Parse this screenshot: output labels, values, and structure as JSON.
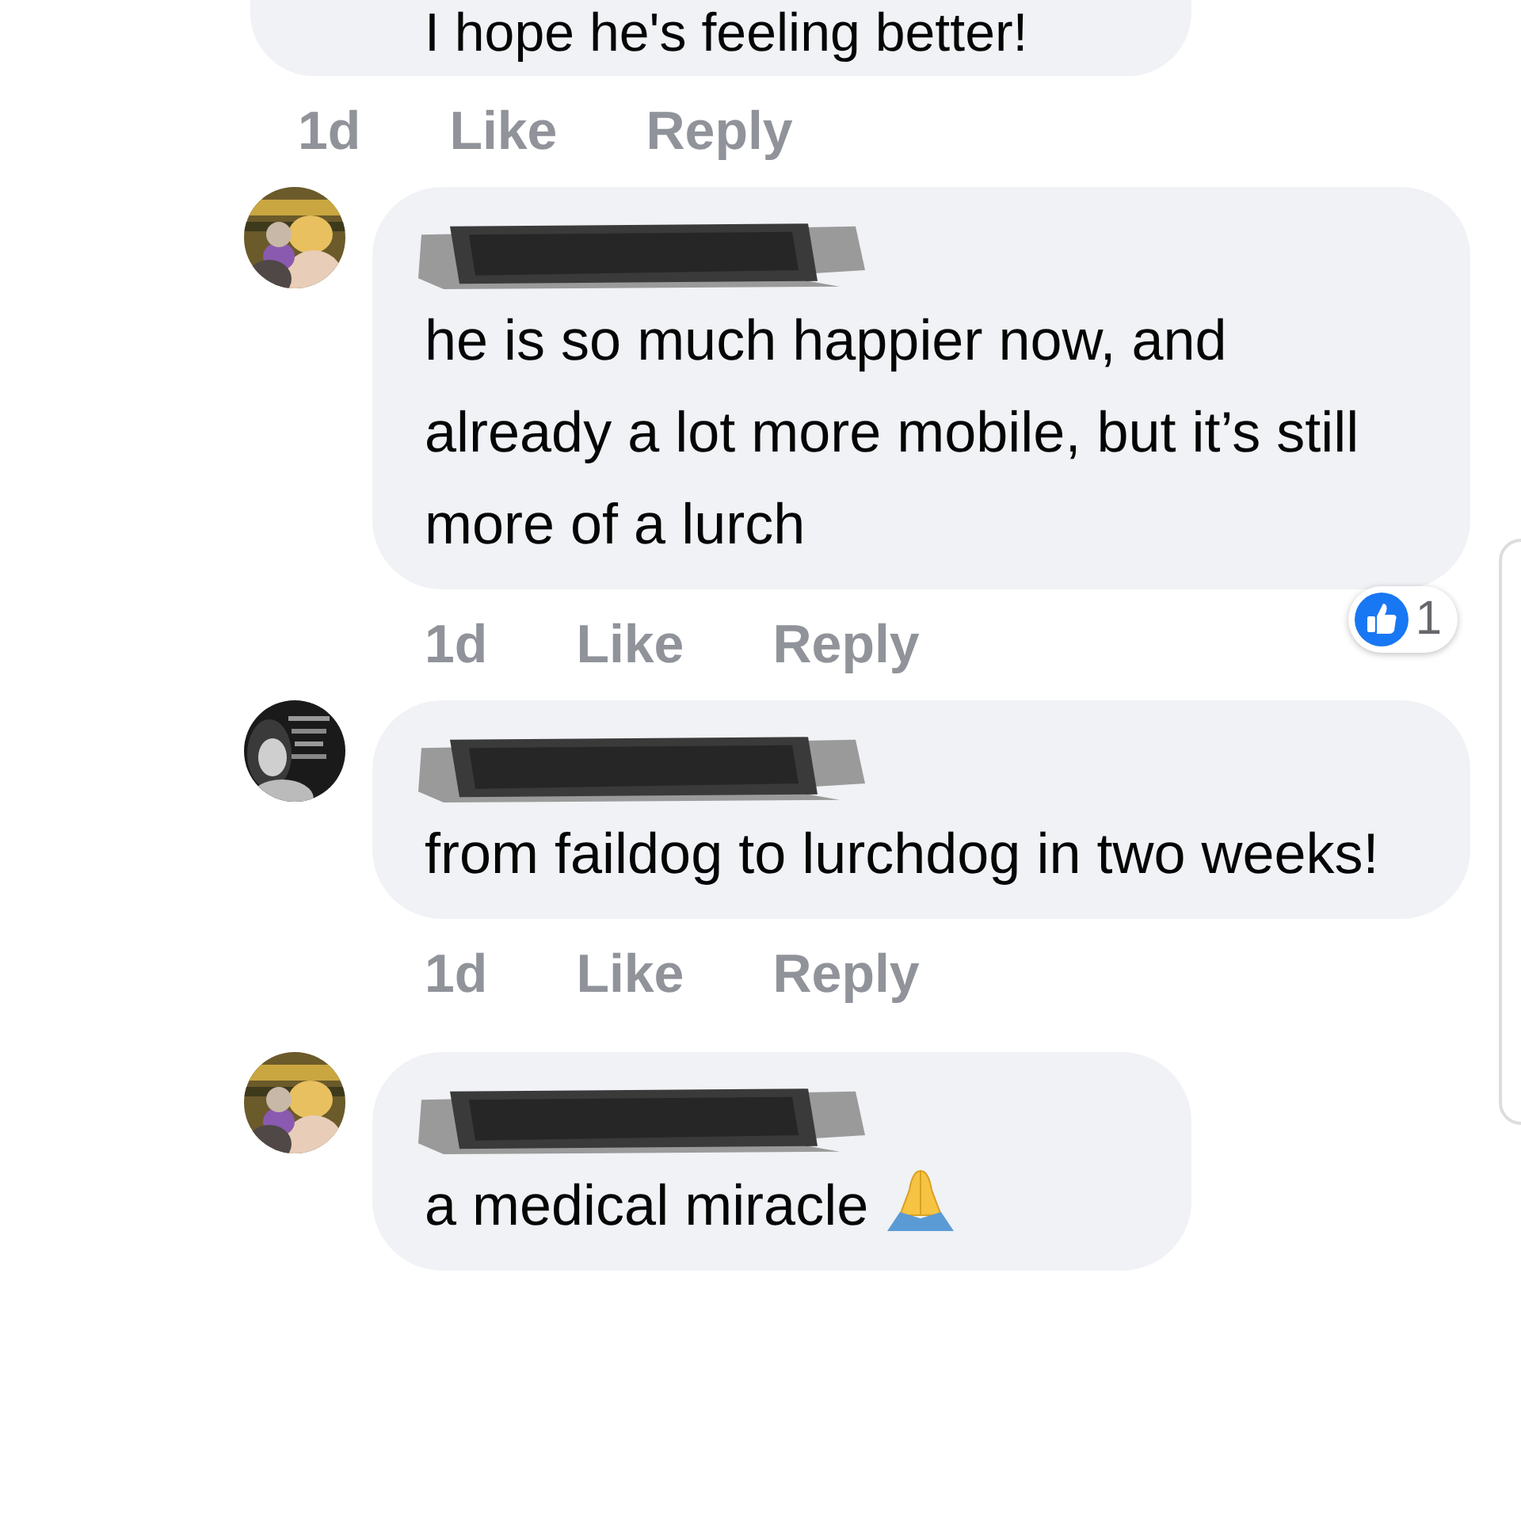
{
  "comments": [
    {
      "kind": "top",
      "author_redacted": false,
      "text": "I hope he's feeling better!",
      "time": "1d",
      "actions": [
        "Like",
        "Reply"
      ],
      "emoji": false
    },
    {
      "kind": "reply",
      "author_redacted": true,
      "text": "he is so much happier now, and already a lot more mobile, but it’s still more of a lurch",
      "time": "1d",
      "actions": [
        "Like",
        "Reply"
      ],
      "reaction_count": "1",
      "emoji": false
    },
    {
      "kind": "reply",
      "author_redacted": true,
      "text": "from faildog to lurchdog in two weeks!",
      "time": "1d",
      "actions": [
        "Like",
        "Reply"
      ],
      "emoji": false
    },
    {
      "kind": "reply",
      "author_redacted": true,
      "text": "a medical miracle",
      "emoji": true
    }
  ]
}
